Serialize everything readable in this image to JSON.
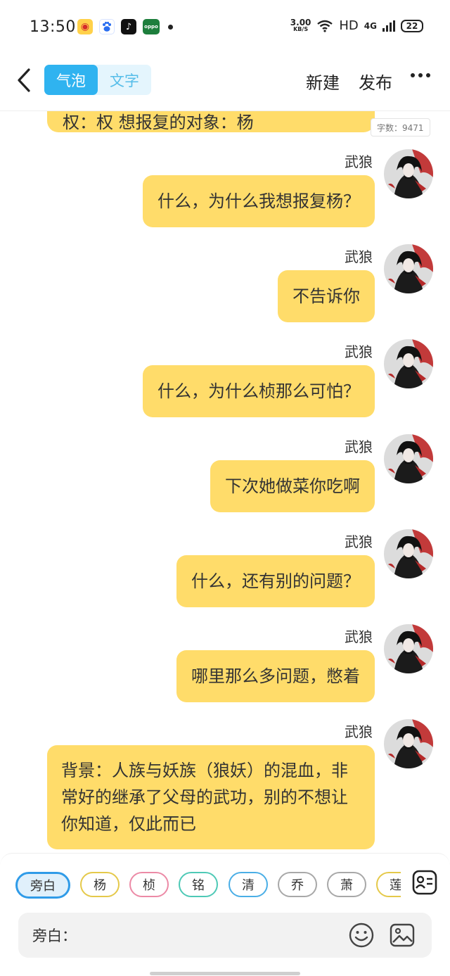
{
  "status_bar": {
    "time": "13:50",
    "net_speed_value": "3.00",
    "net_speed_unit": "KB/S",
    "hd": "HD",
    "network": "4G",
    "battery": "22",
    "app_icons": [
      "weibo-icon",
      "baidu-icon",
      "tiktok-icon",
      "oppo-icon"
    ]
  },
  "header": {
    "tabs": [
      {
        "label": "气泡",
        "active": true
      },
      {
        "label": "文字",
        "active": false
      }
    ],
    "new_label": "新建",
    "publish_label": "发布"
  },
  "word_count": "字数：9471",
  "partial_message_text": "权：权 想报复的对象：杨",
  "messages": [
    {
      "sender": "武狼",
      "text": "什么，为什么我想报复杨？"
    },
    {
      "sender": "武狼",
      "text": "不告诉你"
    },
    {
      "sender": "武狼",
      "text": "什么，为什么桢那么可怕？"
    },
    {
      "sender": "武狼",
      "text": "下次她做菜你吃啊"
    },
    {
      "sender": "武狼",
      "text": "什么，还有别的问题？"
    },
    {
      "sender": "武狼",
      "text": "哪里那么多问题，憋着"
    },
    {
      "sender": "武狼",
      "text": "背景：人族与妖族（狼妖）的混血，非常好的继承了父母的武功，别的不想让你知道，仅此而已"
    }
  ],
  "characters": [
    {
      "name": "旁白",
      "color": "#2f9be8",
      "selected": true
    },
    {
      "name": "杨",
      "color": "#e5c94a",
      "selected": false
    },
    {
      "name": "桢",
      "color": "#ec8aa6",
      "selected": false
    },
    {
      "name": "铭",
      "color": "#4ec9b6",
      "selected": false
    },
    {
      "name": "清",
      "color": "#4aaee6",
      "selected": false
    },
    {
      "name": "乔",
      "color": "#a8a8a8",
      "selected": false
    },
    {
      "name": "萧",
      "color": "#a8a8a8",
      "selected": false
    },
    {
      "name": "莲",
      "color": "#e5c94a",
      "selected": false
    }
  ],
  "input": {
    "label": "旁白："
  },
  "colors": {
    "bubble": "#ffdc6a",
    "accent": "#2fb3f0"
  }
}
